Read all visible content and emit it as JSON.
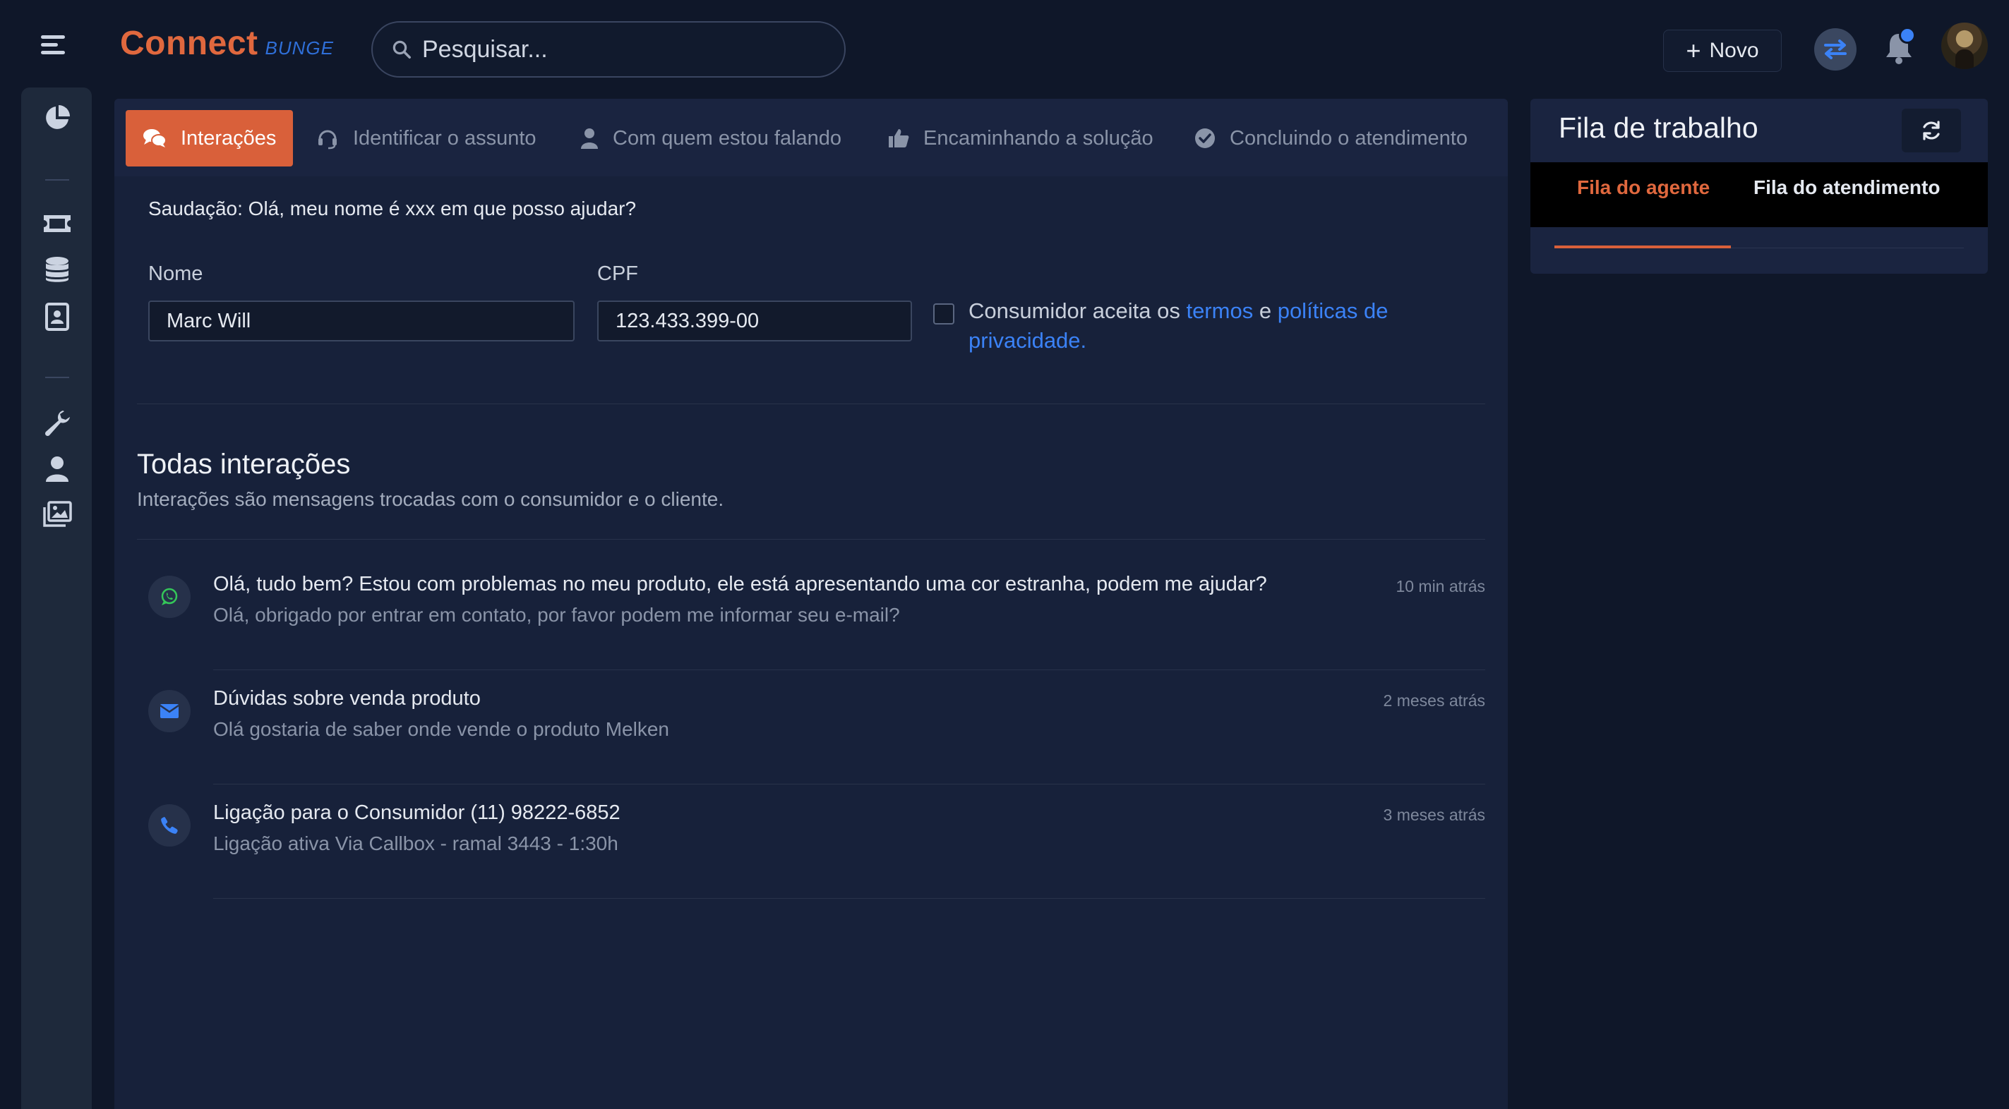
{
  "brand": {
    "name": "Connect",
    "sub": "BUNGE"
  },
  "search": {
    "placeholder": "Pesquisar..."
  },
  "header": {
    "new_label": "Novo"
  },
  "tabs": [
    {
      "label": "Interações",
      "icon": "comments-icon",
      "active": true
    },
    {
      "label": "Identificar o assunto",
      "icon": "headset-icon",
      "active": false
    },
    {
      "label": "Com quem estou falando",
      "icon": "user-icon",
      "active": false
    },
    {
      "label": "Encaminhando a solução",
      "icon": "thumbs-up-icon",
      "active": false
    },
    {
      "label": "Concluindo o atendimento",
      "icon": "check-circle-icon",
      "active": false
    }
  ],
  "form": {
    "greeting": "Saudação: Olá, meu nome é xxx em que posso ajudar?",
    "name_label": "Nome",
    "name_value": "Marc Will",
    "cpf_label": "CPF",
    "cpf_value": "123.433.399-00",
    "consent_prefix": "Consumidor aceita os",
    "consent_terms": "termos",
    "consent_and": "e",
    "consent_policy": "políticas de privacidade."
  },
  "interactions_section": {
    "title": "Todas interações",
    "subtitle": "Interações são mensagens trocadas com o consumidor e o cliente.",
    "items": [
      {
        "icon": "whatsapp-icon",
        "title": "Olá, tudo bem? Estou com problemas no meu produto, ele está apresentando uma cor estranha, podem me ajudar?",
        "description": "Olá, obrigado por entrar em contato, por favor podem me informar seu e-mail?",
        "time": "10 min atrás"
      },
      {
        "icon": "envelope-icon",
        "title": "Dúvidas sobre venda produto",
        "description": "Olá gostaria de saber onde vende o produto Melken",
        "time": "2 meses atrás"
      },
      {
        "icon": "phone-icon",
        "title": "Ligação para o Consumidor (11) 98222-6852",
        "description": "Ligação ativa Via Callbox - ramal 3443 - 1:30h",
        "time": "3 meses atrás"
      }
    ]
  },
  "queue": {
    "title": "Fila de trabalho",
    "tabs": [
      {
        "label": "Fila do agente",
        "active": true
      },
      {
        "label": "Fila do atendimento",
        "active": false
      }
    ]
  },
  "colors": {
    "accent": "#d9603a",
    "brand": "#e0683e",
    "link": "#3b82f6",
    "background": "#0f1729",
    "panel": "#17213a"
  }
}
